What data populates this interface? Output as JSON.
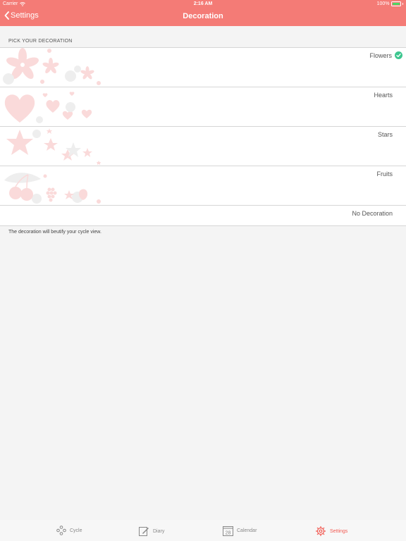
{
  "status_bar": {
    "carrier": "Carrier",
    "time": "2:16 AM",
    "battery": "100%",
    "battery_level": 1.0
  },
  "nav": {
    "back_label": "Settings",
    "title": "Decoration"
  },
  "section_header": "PICK YOUR DECORATION",
  "options": [
    {
      "label": "Flowers",
      "selected": true,
      "icon": "flowers-decoration"
    },
    {
      "label": "Hearts",
      "selected": false,
      "icon": "hearts-decoration"
    },
    {
      "label": "Stars",
      "selected": false,
      "icon": "stars-decoration"
    },
    {
      "label": "Fruits",
      "selected": false,
      "icon": "fruits-decoration"
    },
    {
      "label": "No Decoration",
      "selected": false,
      "icon": ""
    }
  ],
  "footer_note": "The decoration will beutify your cycle view.",
  "tabs": [
    {
      "label": "Cycle",
      "icon": "cycle-icon",
      "active": false
    },
    {
      "label": "Diary",
      "icon": "diary-icon",
      "active": false
    },
    {
      "label": "Calendar",
      "icon": "calendar-icon",
      "active": false,
      "icon_text": "28"
    },
    {
      "label": "Settings",
      "icon": "settings-gear-icon",
      "active": true
    }
  ],
  "colors": {
    "accent": "#f47b76",
    "active_tab": "#f25a52",
    "check": "#3dc68f",
    "decoration": "#fadada",
    "decoration_grey": "#eeeeee"
  }
}
